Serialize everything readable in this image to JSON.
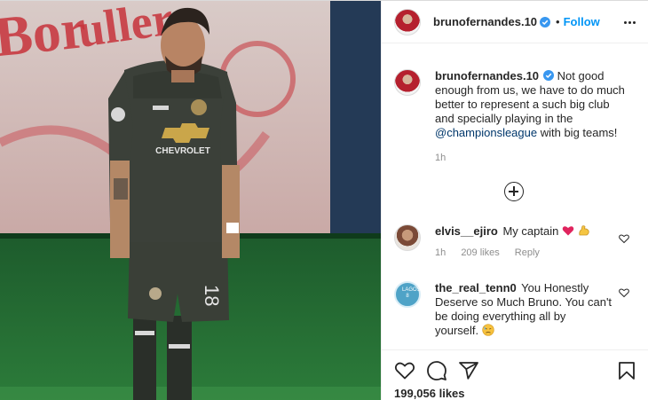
{
  "post": {
    "author": "brunofernandes.10",
    "follow_label": "Follow",
    "dot": "•",
    "caption": {
      "username": "brunofernandes.10",
      "text_before": "Not good enough from us, we have to do much better to represent a such big club and specially playing in the ",
      "mention": "@championsleague",
      "text_after": " with big teams!",
      "time": "1h"
    },
    "comments": [
      {
        "username": "elvis__ejiro",
        "text": "My captain",
        "emoji": [
          "red-heart-emoji",
          "flexed-biceps-emoji"
        ],
        "time": "1h",
        "likes": "209 likes",
        "reply": "Reply"
      },
      {
        "username": "the_real_tenn0",
        "text": "You Honestly Deserve so Much Bruno. You can't be doing everything all by yourself.",
        "emoji": [
          "downcast-face-emoji"
        ],
        "avatar_text": "LAGOS 8"
      }
    ],
    "likes_count": "199,056 likes",
    "photo_text": {
      "sponsor": "CHEVROLET",
      "shorts_number": "18",
      "banner": "Bor Buller"
    },
    "icons": [
      "verified-badge-icon",
      "more-options-icon",
      "load-more-comments-icon",
      "like-icon",
      "comment-icon",
      "share-icon",
      "save-icon"
    ],
    "colors": {
      "accent": "#0095f6",
      "verified": "#3897f0",
      "kit": "#3a3f37",
      "pitch": "#2f7d3a"
    }
  }
}
